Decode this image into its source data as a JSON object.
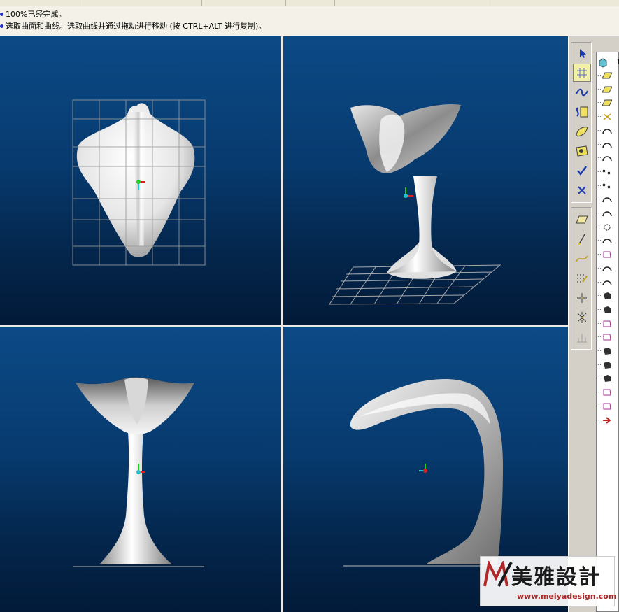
{
  "messages": {
    "line1": "100%已经完成。",
    "line2": "选取曲面和曲线。选取曲线并通过拖动进行移动 (按 CTRL+ALT 进行复制)。"
  },
  "colors": {
    "viewport_top": "#0c4a86",
    "viewport_bottom": "#021a38",
    "message_bullet": "#2030c0",
    "logo_accent": "#b0282a"
  },
  "viewports": [
    {
      "name": "top-view",
      "content": "control-net-over-surface"
    },
    {
      "name": "perspective-view",
      "content": "model-with-ground-grid"
    },
    {
      "name": "front-view",
      "content": "model-on-ground-line"
    },
    {
      "name": "right-view",
      "content": "curved-model-on-ground-line"
    }
  ],
  "toolbar": {
    "top_group": [
      "pointer-icon",
      "control-points-icon",
      "curve-wave-icon",
      "surface-edit-icon",
      "surface-patch-icon",
      "surface-select-icon",
      "check-icon",
      "cancel-x-icon"
    ],
    "bottom_group": [
      "plane-icon",
      "line-icon",
      "spline-icon",
      "grid-dots-icon",
      "explode-icon",
      "scatter-icon",
      "measure-icon"
    ]
  },
  "tree": {
    "header_icon": "cube-icon",
    "items": [
      "plane-feature-icon",
      "plane-feature-icon",
      "plane-feature-icon",
      "point-feature-icon",
      "arc-feature-icon",
      "arc-feature-icon",
      "arc-feature-icon",
      "cross-points-icon",
      "cross-points-icon",
      "arc-feature-icon",
      "arc-feature-icon",
      "round-feature-icon",
      "arc-feature-icon",
      "surface-feature-icon",
      "arc-feature-icon",
      "arc-feature-icon",
      "solid-feature-icon",
      "solid-feature-icon",
      "surface-feature-icon",
      "surface-feature-icon",
      "solid-feature-icon",
      "solid-feature-icon",
      "solid-feature-icon",
      "surface-feature-icon",
      "surface-feature-icon",
      "insert-arrow-icon"
    ]
  },
  "logo": {
    "main": "美雅設計",
    "url": "www.meiyadesign.com"
  }
}
